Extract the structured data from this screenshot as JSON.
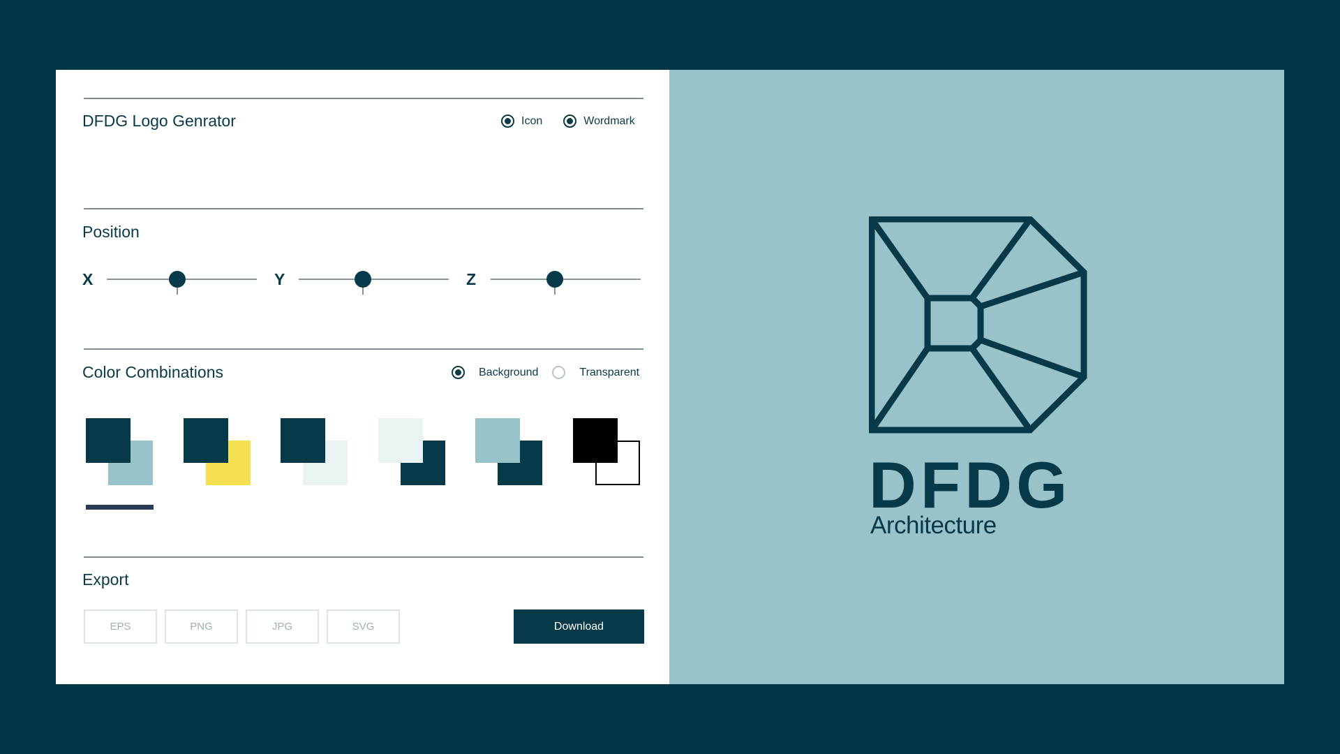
{
  "generator": {
    "title": "DFDG Logo Genrator",
    "logo_type_options": [
      {
        "label": "Icon",
        "checked": true
      },
      {
        "label": "Wordmark",
        "checked": true
      }
    ]
  },
  "position": {
    "title": "Position",
    "sliders": [
      {
        "axis": "X",
        "value": 0.47
      },
      {
        "axis": "Y",
        "value": 0.43
      },
      {
        "axis": "Z",
        "value": 0.43
      }
    ]
  },
  "colors": {
    "title": "Color Combinations",
    "mode_options": [
      {
        "label": "Background",
        "checked": true
      },
      {
        "label": "Transparent",
        "checked": false
      }
    ],
    "swatches": [
      {
        "front": "#063a48",
        "back": "#98c3ca",
        "selected": true
      },
      {
        "front": "#063a48",
        "back": "#f5e052",
        "selected": false
      },
      {
        "front": "#063a48",
        "back": "#eaf2f3",
        "selected": false
      },
      {
        "front": "#eaf2f3",
        "back": "#063a48",
        "selected": false
      },
      {
        "front": "#98c3ca",
        "back": "#063a48",
        "selected": false
      },
      {
        "front": "#000000",
        "back": "#ffffff",
        "selected": false
      }
    ]
  },
  "export": {
    "title": "Export",
    "formats": [
      "EPS",
      "PNG",
      "JPG",
      "SVG"
    ],
    "download_label": "Download"
  },
  "preview": {
    "wordmark": "DFDG",
    "tagline": "Architecture",
    "background": "#98c3ca",
    "foreground": "#063a48"
  }
}
